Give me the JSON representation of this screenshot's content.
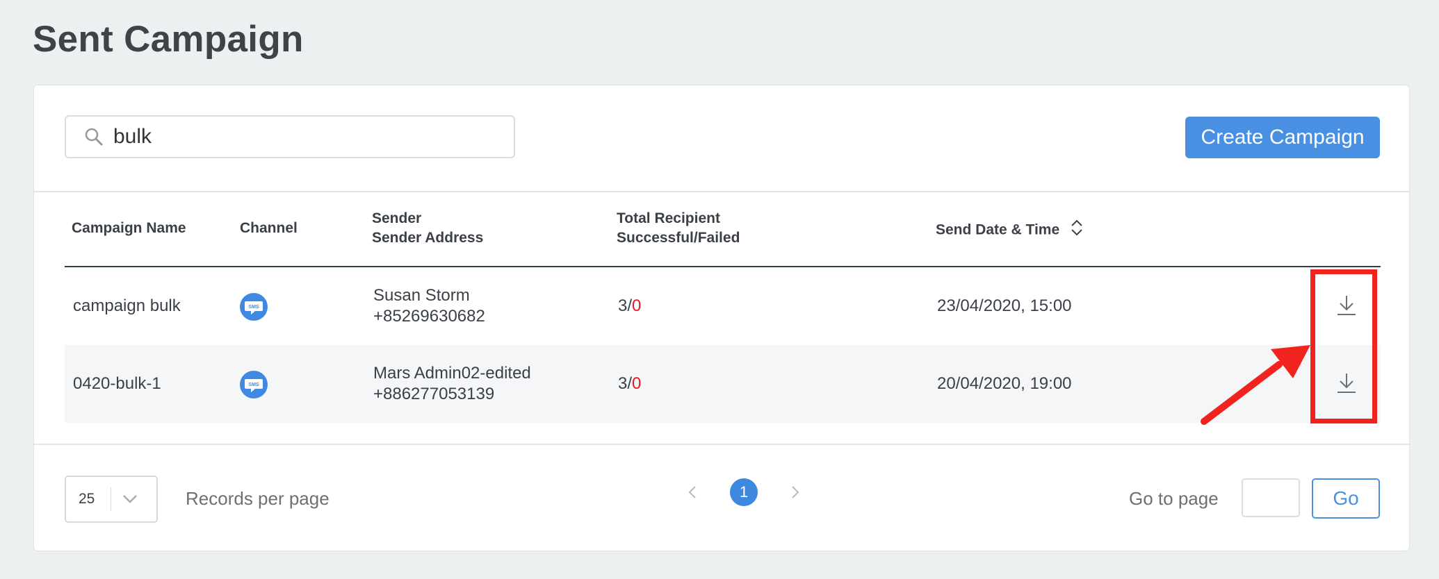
{
  "page": {
    "title": "Sent Campaign"
  },
  "toolbar": {
    "search_value": "bulk",
    "create_label": "Create Campaign"
  },
  "table": {
    "headers": {
      "campaign_name": "Campaign Name",
      "channel": "Channel",
      "sender_line1": "Sender",
      "sender_line2": "Sender Address",
      "recipient_line1": "Total Recipient",
      "recipient_line2": "Successful/Failed",
      "send_date": "Send Date & Time"
    },
    "rows": [
      {
        "name": "campaign bulk",
        "channel": "SMS",
        "sender": "Susan Storm",
        "address": "+85269630682",
        "successful": "3/",
        "failed": "0",
        "date": "23/04/2020, 15:00"
      },
      {
        "name": "0420-bulk-1",
        "channel": "SMS",
        "sender": "Mars Admin02-edited",
        "address": "+886277053139",
        "successful": "3/",
        "failed": "0",
        "date": "20/04/2020, 19:00"
      }
    ]
  },
  "pagination": {
    "per_page_value": "25",
    "per_page_label": "Records per page",
    "current_page": "1",
    "goto_label": "Go to page",
    "go_label": "Go"
  },
  "colors": {
    "accent": "#4a90e2",
    "failed": "#e0192b",
    "annotation": "#f0231e"
  },
  "icons": [
    "search-icon",
    "sms-icon",
    "sort-icon",
    "download-icon",
    "chevron-down-icon",
    "chevron-left-icon",
    "chevron-right-icon"
  ]
}
